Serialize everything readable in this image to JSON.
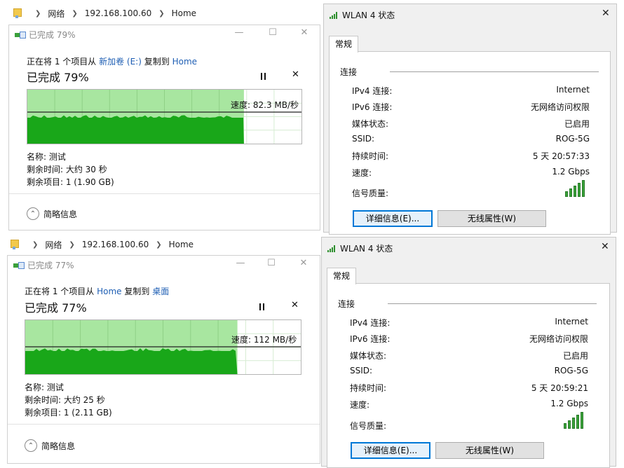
{
  "top": {
    "breadcrumb": [
      "网络",
      "192.168.100.60",
      "Home"
    ],
    "copy": {
      "title": "已完成 79%",
      "desc_prefix": "正在将 1 个项目从",
      "source": "新加卷 (E:)",
      "desc_middle": "复制到",
      "dest": "Home",
      "progress_text": "已完成 79%",
      "progress": 0.79,
      "speed": "速度: 82.3 MB/秒",
      "name": "名称: 测试",
      "remaining_time": "剩余时间: 大约 30 秒",
      "remaining_items": "剩余项目: 1 (1.90 GB)",
      "less_details": "简略信息"
    },
    "wlan": {
      "title": "WLAN 4 状态",
      "tab": "常规",
      "group": "连接",
      "rows": [
        {
          "label": "IPv4 连接:",
          "value": "Internet"
        },
        {
          "label": "IPv6 连接:",
          "value": "无网络访问权限"
        },
        {
          "label": "媒体状态:",
          "value": "已启用"
        },
        {
          "label": "SSID:",
          "value": "ROG-5G"
        },
        {
          "label": "持续时间:",
          "value": "5 天 20:57:33"
        },
        {
          "label": "速度:",
          "value": "1.2 Gbps"
        }
      ],
      "signal_label": "信号质量:",
      "signal_bars": 5,
      "details_button": "详细信息(E)...",
      "wireless_button": "无线属性(W)"
    }
  },
  "bottom": {
    "breadcrumb": [
      "网络",
      "192.168.100.60",
      "Home"
    ],
    "copy": {
      "title": "已完成 77%",
      "desc_prefix": "正在将 1 个项目从",
      "source": "Home",
      "desc_middle": "复制到",
      "dest": "桌面",
      "progress_text": "已完成 77%",
      "progress": 0.77,
      "speed": "速度: 112 MB/秒",
      "name": "名称: 测试",
      "remaining_time": "剩余时间: 大约 25 秒",
      "remaining_items": "剩余项目: 1 (2.11 GB)",
      "less_details": "简略信息"
    },
    "wlan": {
      "title": "WLAN 4 状态",
      "tab": "常规",
      "group": "连接",
      "rows": [
        {
          "label": "IPv4 连接:",
          "value": "Internet"
        },
        {
          "label": "IPv6 连接:",
          "value": "无网络访问权限"
        },
        {
          "label": "媒体状态:",
          "value": "已启用"
        },
        {
          "label": "SSID:",
          "value": "ROG-5G"
        },
        {
          "label": "持续时间:",
          "value": "5 天 20:59:21"
        },
        {
          "label": "速度:",
          "value": "1.2 Gbps"
        }
      ],
      "signal_label": "信号质量:",
      "signal_bars": 5,
      "details_button": "详细信息(E)...",
      "wireless_button": "无线属性(W)"
    }
  },
  "colors": {
    "graph_fill_light": "#a8e6a0",
    "graph_fill_dark": "#19a719",
    "link": "#1f5fb4",
    "default_button_border": "#0078d7"
  }
}
